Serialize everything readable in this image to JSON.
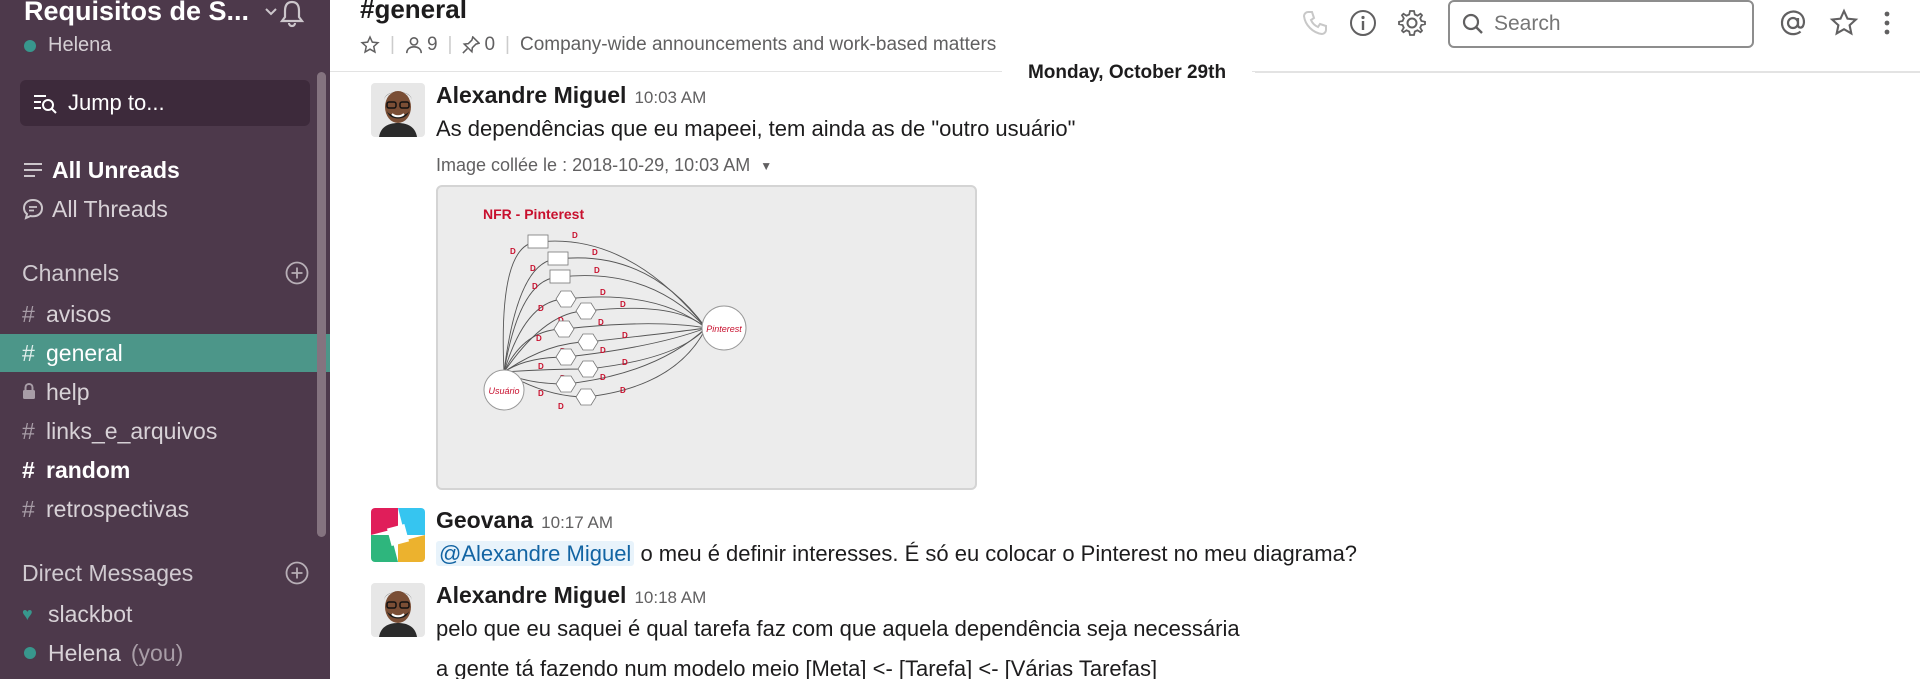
{
  "sidebar": {
    "team_name": "Requisitos de S...",
    "user_name": "Helena",
    "jump_label": "Jump to...",
    "all_unreads": "All Unreads",
    "all_threads": "All Threads",
    "channels_title": "Channels",
    "channels": [
      {
        "name": "avisos",
        "prefix": "#"
      },
      {
        "name": "general",
        "prefix": "#"
      },
      {
        "name": "help",
        "prefix": "lock"
      },
      {
        "name": "links_e_arquivos",
        "prefix": "#"
      },
      {
        "name": "random",
        "prefix": "#"
      },
      {
        "name": "retrospectivas",
        "prefix": "#"
      }
    ],
    "dm_title": "Direct Messages",
    "dms": [
      {
        "name": "slackbot",
        "suffix": ""
      },
      {
        "name": "Helena",
        "suffix": "(you)"
      }
    ]
  },
  "header": {
    "channel": "#general",
    "member_count": "9",
    "pin_count": "0",
    "topic": "Company-wide announcements and work-based matters",
    "search_placeholder": "Search"
  },
  "date_divider": "Monday, October 29th",
  "messages": [
    {
      "author": "Alexandre Miguel",
      "time": "10:03 AM",
      "text": "As dependências que eu mapeei, tem ainda as de \"outro usuário\"",
      "attachment_meta": "Image collée le :  2018-10-29, 10:03 AM",
      "attachment_title": "NFR - Pinterest"
    },
    {
      "author": "Geovana",
      "time": "10:17 AM",
      "mention": "@Alexandre Miguel",
      "text": " o meu é definir interesses. É só eu colocar o Pinterest no meu diagrama?"
    },
    {
      "author": "Alexandre Miguel",
      "time": "10:18 AM",
      "text": "pelo que eu saquei é qual tarefa faz com que aquela dependência seja necessária",
      "text2": "a gente tá fazendo num modelo meio [Meta] <- [Tarefa] <- [Várias Tarefas]"
    }
  ],
  "diagram": {
    "actor_left": "Usuário",
    "actor_right": "Pinterest",
    "dep_label": "D"
  },
  "colors": {
    "sidebar_bg": "#4d394b",
    "active_channel": "#4c9689",
    "presence": "#38978d",
    "diagram_red": "#c8102e"
  }
}
